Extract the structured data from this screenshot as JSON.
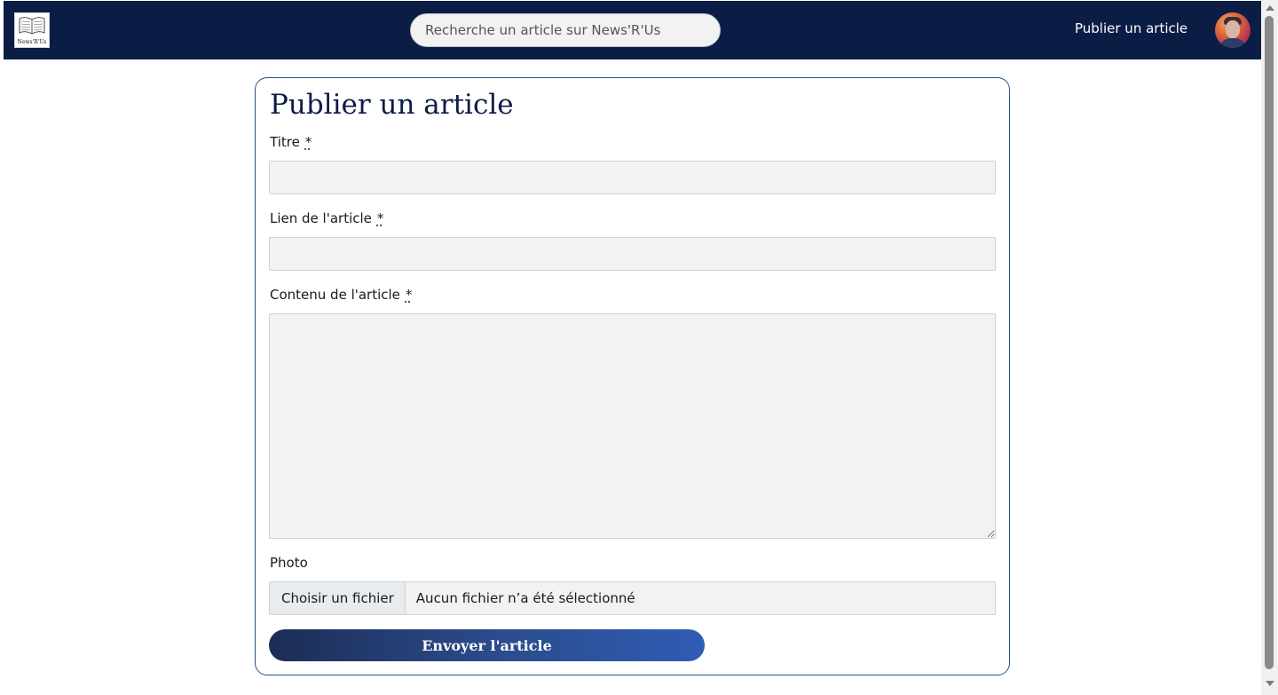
{
  "navbar": {
    "logo_text": "News'R'Us",
    "search_placeholder": "Recherche un article sur News'R'Us",
    "publish_link": "Publier un article",
    "bg_color": "#0b1d45"
  },
  "form": {
    "title": "Publier un article",
    "required_marker": "*",
    "fields": {
      "titre_label": "Titre",
      "titre_value": "",
      "lien_label": "Lien de l'article",
      "lien_value": "",
      "contenu_label": "Contenu de l'article",
      "contenu_value": "",
      "photo_label": "Photo",
      "file_button": "Choisir un fichier",
      "file_status": "Aucun fichier n’a été sélectionné"
    },
    "submit_label": "Envoyer l'article",
    "accent_color": "#2a5188"
  },
  "icons": {
    "logo": "newspaper-logo-icon",
    "avatar": "user-avatar",
    "resize": "resize-grip-icon"
  }
}
